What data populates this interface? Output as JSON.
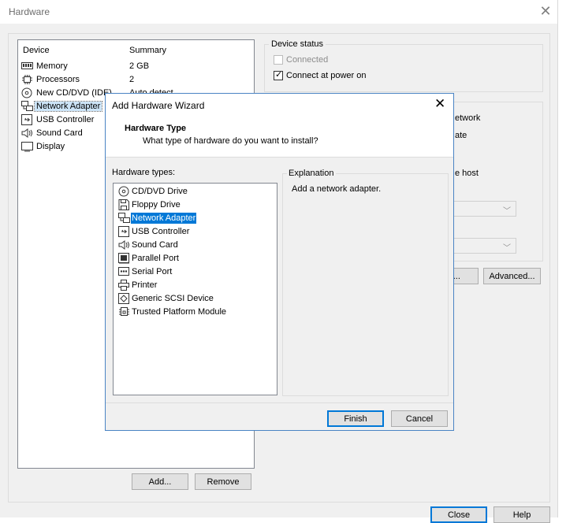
{
  "window": {
    "title": "Hardware"
  },
  "device_list": {
    "headers": {
      "device": "Device",
      "summary": "Summary"
    },
    "items": [
      {
        "label": "Memory",
        "summary": "2 GB",
        "icon": "memory-icon"
      },
      {
        "label": "Processors",
        "summary": "2",
        "icon": "processor-icon"
      },
      {
        "label": "New CD/DVD (IDE)",
        "summary": "Auto detect",
        "icon": "cd-dvd-icon"
      },
      {
        "label": "Network Adapter",
        "summary": "",
        "icon": "network-adapter-icon"
      },
      {
        "label": "USB Controller",
        "summary": "",
        "icon": "usb-icon"
      },
      {
        "label": "Sound Card",
        "summary": "",
        "icon": "sound-icon"
      },
      {
        "label": "Display",
        "summary": "",
        "icon": "display-icon"
      }
    ]
  },
  "buttons": {
    "add": "Add...",
    "remove": "Remove",
    "close": "Close",
    "help": "Help",
    "segments": "nts...",
    "advanced": "Advanced..."
  },
  "device_status": {
    "title": "Device status",
    "connected": "Connected",
    "connect_at_power_on": "Connect at power on"
  },
  "network_partial": {
    "line1": "etwork",
    "line2": "ate",
    "line3": "e host"
  },
  "wizard": {
    "title": "Add Hardware Wizard",
    "heading": "Hardware Type",
    "subheading": "What type of hardware do you want to install?",
    "types_label": "Hardware types:",
    "types": [
      {
        "label": "CD/DVD Drive",
        "icon": "cd-dvd-icon"
      },
      {
        "label": "Floppy Drive",
        "icon": "floppy-icon"
      },
      {
        "label": "Network Adapter",
        "icon": "network-adapter-icon"
      },
      {
        "label": "USB Controller",
        "icon": "usb-icon"
      },
      {
        "label": "Sound Card",
        "icon": "sound-icon"
      },
      {
        "label": "Parallel Port",
        "icon": "parallel-port-icon"
      },
      {
        "label": "Serial Port",
        "icon": "serial-port-icon"
      },
      {
        "label": "Printer",
        "icon": "printer-icon"
      },
      {
        "label": "Generic SCSI Device",
        "icon": "scsi-icon"
      },
      {
        "label": "Trusted Platform Module",
        "icon": "tpm-icon"
      }
    ],
    "explanation_title": "Explanation",
    "explanation_text": "Add a network adapter.",
    "finish": "Finish",
    "cancel": "Cancel"
  }
}
